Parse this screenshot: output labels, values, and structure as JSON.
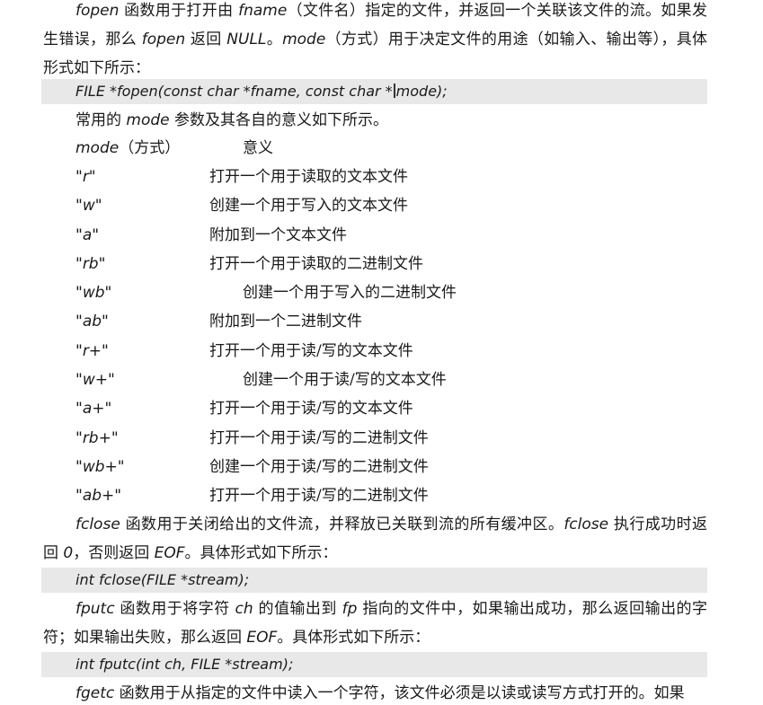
{
  "fopen_section": {
    "intro": {
      "p1": "fopen",
      "p2": " 函数用于打开由 ",
      "p3": "fname",
      "p4": "（文件名）指定的文件，并返回一个关联该文件的流。如果发生错误，那么 ",
      "p5": "fopen",
      "p6": " 返回 ",
      "p7": "NULL",
      "p8": "。",
      "p9": "mode",
      "p10": "（方式）用于决定文件的用途（如输入、输出等），具体形式如下所示："
    },
    "prototype_a": "FILE *fopen(const char *fname, const char *",
    "prototype_b": "mode);",
    "mode_intro_a": "常用的 ",
    "mode_intro_b": "mode",
    "mode_intro_c": " 参数及其各自的意义如下所示。",
    "table_header": {
      "mode": "mode",
      "mode_cn": "（方式）",
      "meaning": "意义"
    },
    "modes": [
      {
        "code": "\"r\"",
        "desc": "打开一个用于读取的文本文件"
      },
      {
        "code": "\"w\"",
        "desc": "创建一个用于写入的文本文件"
      },
      {
        "code": "\"a\"",
        "desc": "附加到一个文本文件"
      },
      {
        "code": "\"rb\"",
        "desc": "打开一个用于读取的二进制文件"
      },
      {
        "code": "\"wb\"",
        "desc": "创建一个用于写入的二进制文件"
      },
      {
        "code": "\"ab\"",
        "desc": "附加到一个二进制文件"
      },
      {
        "code": "\"r+\"",
        "desc": "打开一个用于读/写的文本文件"
      },
      {
        "code": "\"w+\"",
        "desc": "创建一个用于读/写的文本文件"
      },
      {
        "code": "\"a+\"",
        "desc": "打开一个用于读/写的文本文件"
      },
      {
        "code": "\"rb+\"",
        "desc": "打开一个用于读/写的二进制文件"
      },
      {
        "code": "\"wb+\"",
        "desc": "创建一个用于读/写的二进制文件"
      },
      {
        "code": "\"ab+\"",
        "desc": "打开一个用于读/写的二进制文件"
      }
    ]
  },
  "fclose_section": {
    "p1": "fclose",
    "p2": " 函数用于关闭给出的文件流，并释放已关联到流的所有缓冲区。",
    "p3": "fclose",
    "p4": " 执行成功时返回 ",
    "p5": "0",
    "p6": "，否则返回 ",
    "p7": "EOF",
    "p8": "。具体形式如下所示：",
    "prototype": "int fclose(FILE *stream);"
  },
  "fputc_section": {
    "p1": "fputc",
    "p2": " 函数用于将字符 ",
    "p3": "ch",
    "p4": " 的值输出到 ",
    "p5": "fp",
    "p6": " 指向的文件中，如果输出成功，那么返回输出的字符；如果输出失败，那么返回 ",
    "p7": "EOF",
    "p8": "。具体形式如下所示：",
    "prototype": "int fputc(int ch, FILE *stream);"
  },
  "fgetc_section": {
    "p1": "fgetc",
    "p2": " 函数用于从指定的文件中读入一个字符，该文件必须是以读或读写方式打开的。如果"
  }
}
